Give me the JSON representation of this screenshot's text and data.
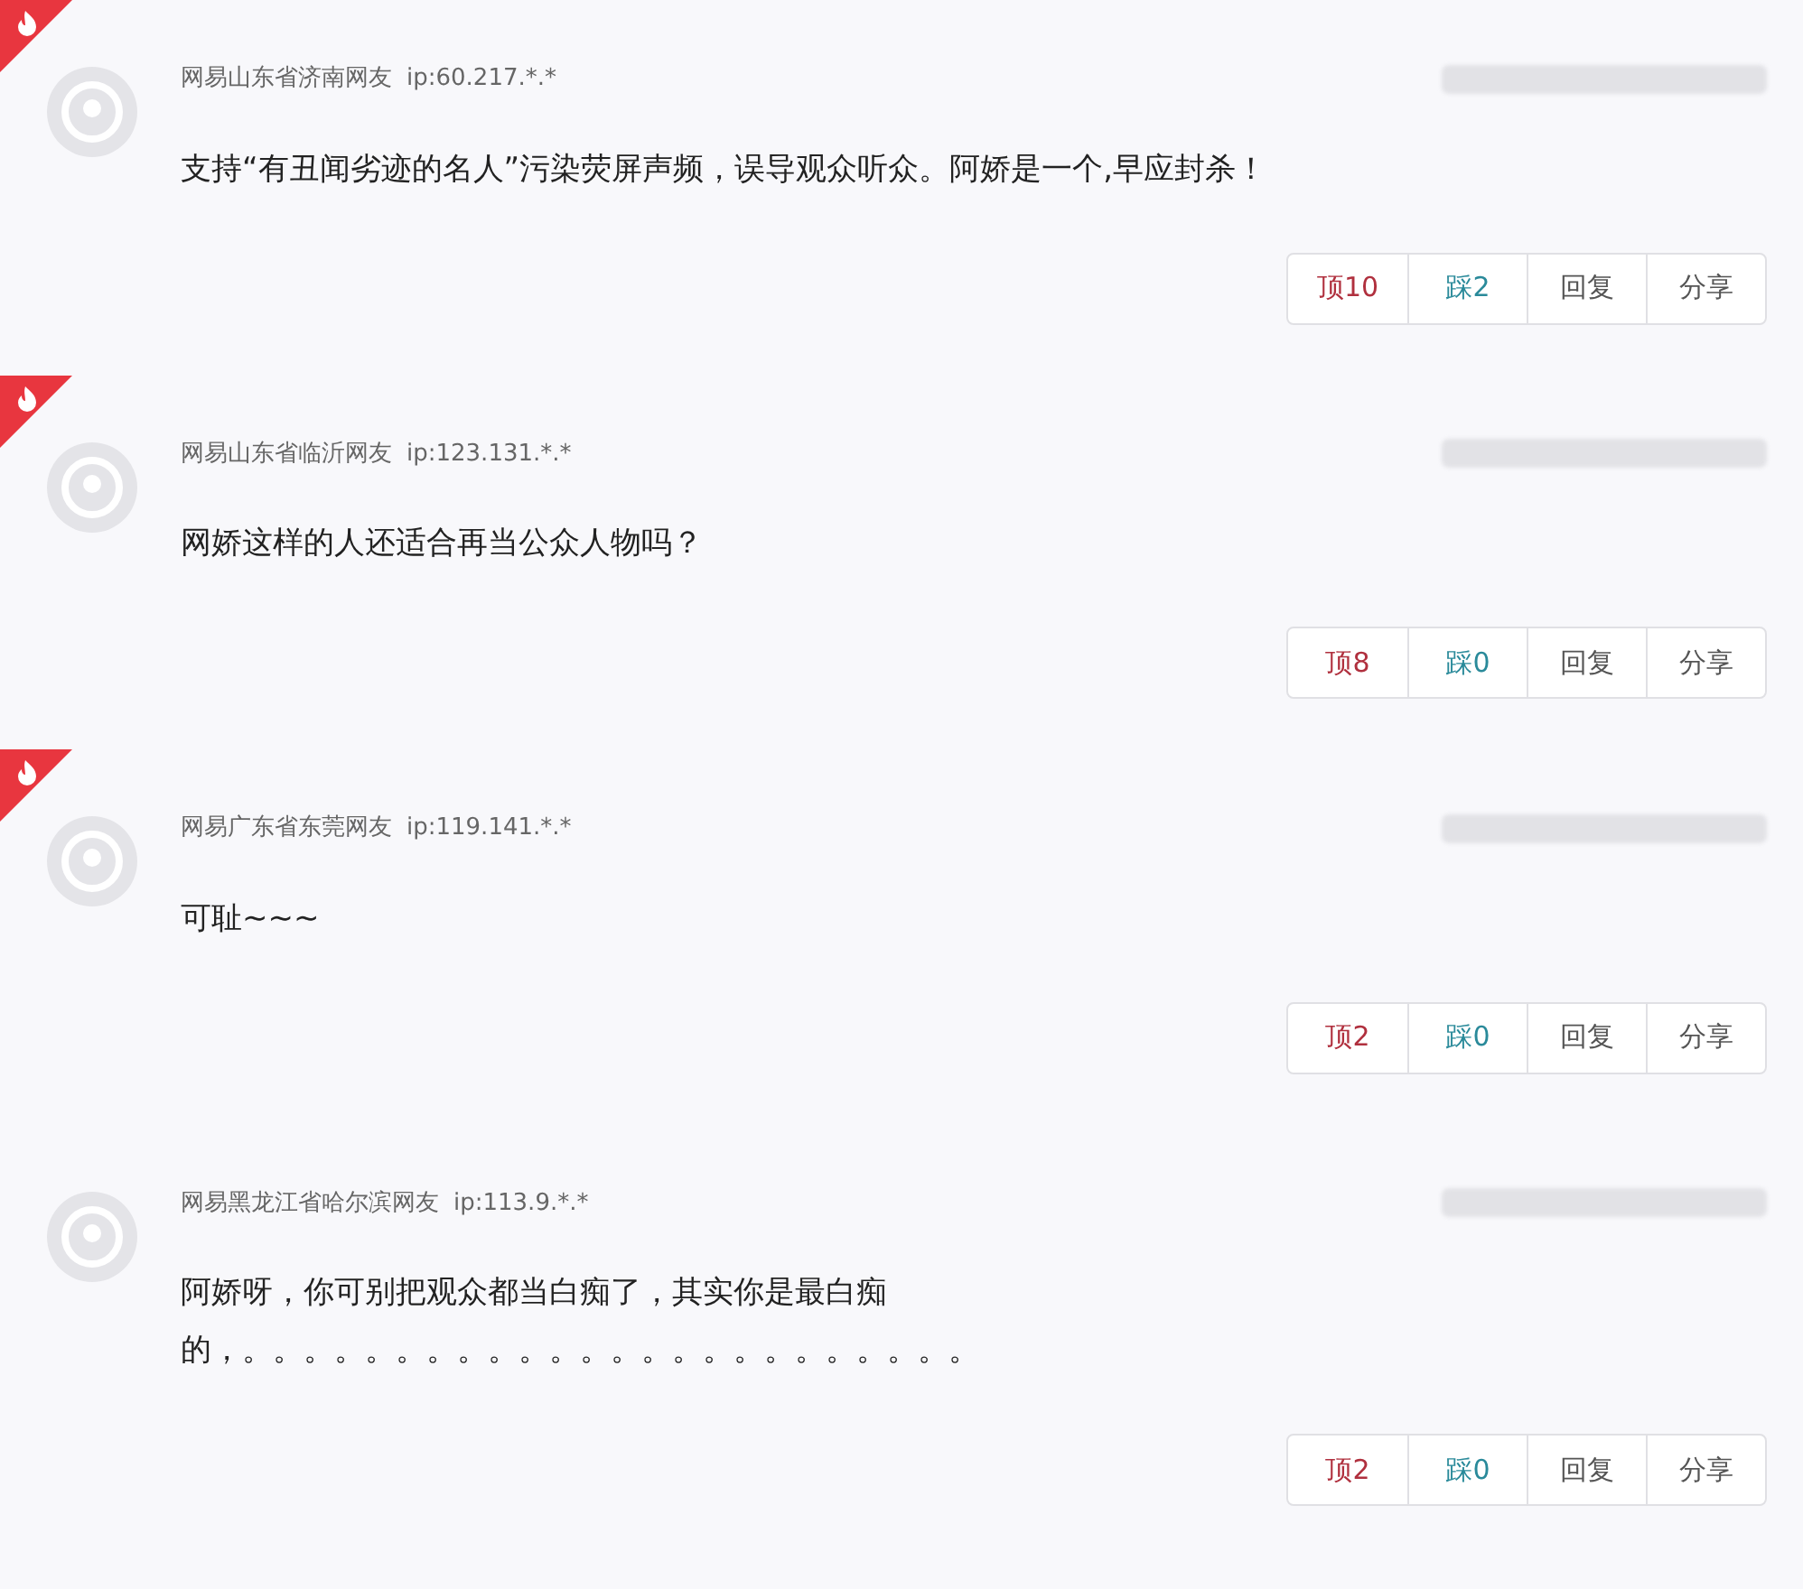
{
  "comments": [
    {
      "hot": true,
      "user": "网易山东省济南网友",
      "ip": "ip:60.217.*.*",
      "text": "支持“有丑闻劣迹的名人”污染荧屏声频，误导观众听众。阿娇是一个,早应封杀！",
      "actions": [
        {
          "kind": "up",
          "label": "顶10"
        },
        {
          "kind": "down",
          "label": "踩2"
        },
        {
          "kind": "plain",
          "label": "回复"
        },
        {
          "kind": "plain",
          "label": "分享"
        }
      ]
    },
    {
      "hot": true,
      "user": "网易山东省临沂网友",
      "ip": "ip:123.131.*.*",
      "text": "网娇这样的人还适合再当公众人物吗？",
      "actions": [
        {
          "kind": "up",
          "label": "顶8"
        },
        {
          "kind": "down",
          "label": "踩0"
        },
        {
          "kind": "plain",
          "label": "回复"
        },
        {
          "kind": "plain",
          "label": "分享"
        }
      ]
    },
    {
      "hot": true,
      "user": "网易广东省东莞网友",
      "ip": "ip:119.141.*.*",
      "text": "可耻~~~",
      "actions": [
        {
          "kind": "up",
          "label": "顶2"
        },
        {
          "kind": "down",
          "label": "踩0"
        },
        {
          "kind": "plain",
          "label": "回复"
        },
        {
          "kind": "plain",
          "label": "分享"
        }
      ]
    },
    {
      "hot": false,
      "user": "网易黑龙江省哈尔滨网友",
      "ip": "ip:113.9.*.*",
      "text": "阿娇呀，你可别把观众都当白痴了，其实你是最白痴的，。。。。。。。。。。。。。。。。。。。。。。。。",
      "actions": [
        {
          "kind": "up",
          "label": "顶2"
        },
        {
          "kind": "down",
          "label": "踩0"
        },
        {
          "kind": "plain",
          "label": "回复"
        },
        {
          "kind": "plain",
          "label": "分享"
        }
      ]
    }
  ]
}
